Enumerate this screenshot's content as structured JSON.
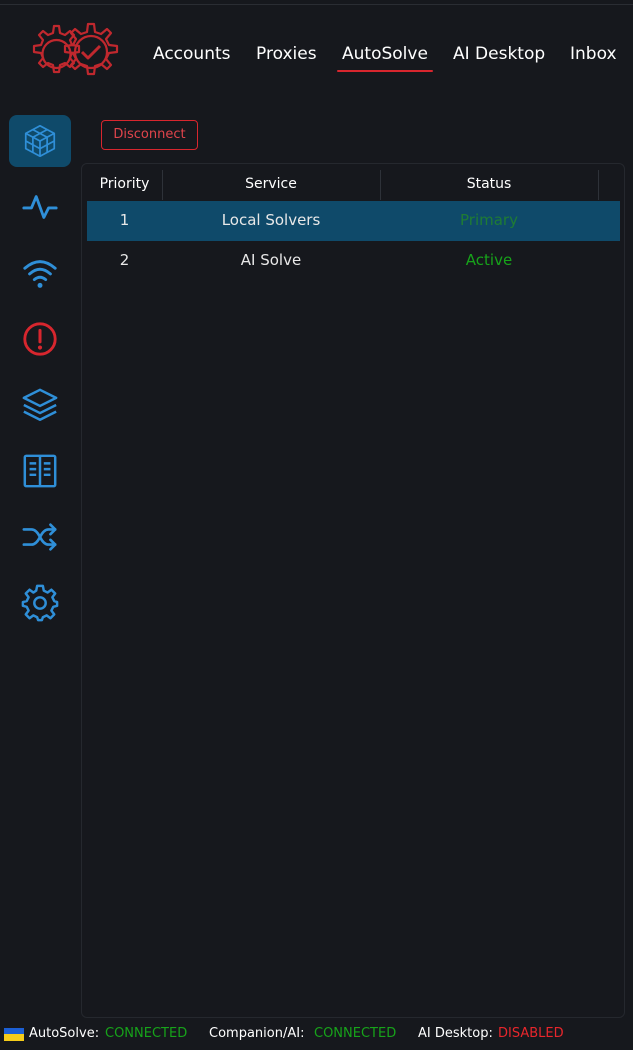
{
  "nav": {
    "items": [
      {
        "label": "Accounts",
        "active": false
      },
      {
        "label": "Proxies",
        "active": false
      },
      {
        "label": "AutoSolve",
        "active": true
      },
      {
        "label": "AI Desktop",
        "active": false
      },
      {
        "label": "Inbox",
        "active": false
      }
    ]
  },
  "sidebar": {
    "items": [
      {
        "icon": "cube-grid-icon",
        "active": true
      },
      {
        "icon": "activity-icon",
        "active": false
      },
      {
        "icon": "wifi-icon",
        "active": false
      },
      {
        "icon": "alert-circle-icon",
        "active": false
      },
      {
        "icon": "layers-icon",
        "active": false
      },
      {
        "icon": "book-icon",
        "active": false
      },
      {
        "icon": "shuffle-icon",
        "active": false
      },
      {
        "icon": "gear-icon",
        "active": false
      }
    ]
  },
  "main": {
    "disconnect_label": "Disconnect",
    "table": {
      "headers": [
        "Priority",
        "Service",
        "Status"
      ],
      "rows": [
        {
          "priority": "1",
          "service": "Local Solvers",
          "status": "Primary",
          "selected": true
        },
        {
          "priority": "2",
          "service": "AI Solve",
          "status": "Active",
          "selected": false
        }
      ]
    }
  },
  "footer": {
    "autosolve_label": "AutoSolve:",
    "autosolve_status": "CONNECTED",
    "companion_label": "Companion/AI:",
    "companion_status": "CONNECTED",
    "aidesktop_label": "AI Desktop:",
    "aidesktop_status": "DISABLED"
  },
  "colors": {
    "accent_red": "#d8262e",
    "accent_blue": "#2f8fd8",
    "selected_bg": "#0f4a6a",
    "status_green": "#17a31a",
    "status_red": "#e8262c"
  }
}
